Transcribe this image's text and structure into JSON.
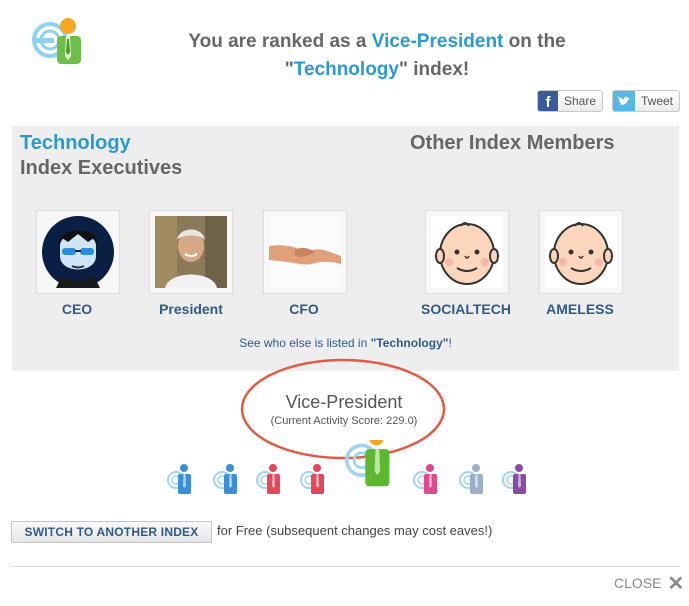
{
  "header": {
    "line1_prefix": "You are ranked as a ",
    "rank": "Vice-President",
    "line1_suffix": " on the",
    "line2_prefix": "\"",
    "index_name": "Technology",
    "line2_suffix": "\" index!"
  },
  "share": {
    "facebook_label": "Share",
    "twitter_label": "Tweet"
  },
  "panel": {
    "title_accent": "Technology",
    "title_rest": "Index Executives",
    "other_title": "Other Index Members",
    "executives": [
      {
        "label": "CEO",
        "icon": "ceo-avatar"
      },
      {
        "label": "President",
        "icon": "president-photo"
      },
      {
        "label": "CFO",
        "icon": "handshake-photo"
      }
    ],
    "others": [
      {
        "label": "SOCIALTECH",
        "icon": "baby-face-avatar"
      },
      {
        "label": "AMELESS",
        "icon": "baby-face-avatar"
      }
    ],
    "see_prefix": "See who else is listed in ",
    "see_link": "\"Technology\"",
    "see_suffix": "!"
  },
  "rank_box": {
    "title": "Vice-President",
    "score": "(Current Activity Score: 229.0)"
  },
  "levels": [
    {
      "color": "#3a8fd6"
    },
    {
      "color": "#3a8fd6"
    },
    {
      "color": "#e4465a"
    },
    {
      "color": "#e4465a"
    },
    {
      "color": "#5cb82e",
      "current": true
    },
    {
      "color": "#e04a8a"
    },
    {
      "color": "#9ab0c8"
    },
    {
      "color": "#8a4aa8"
    }
  ],
  "footer": {
    "switch_label": "SWITCH TO ANOTHER INDEX",
    "switch_text": "for Free (subsequent changes may cost eaves!)",
    "close_label": "CLOSE"
  },
  "colors": {
    "accent": "#2a9ad0",
    "link": "#2e5a8c",
    "ellipse": "#e25b44"
  }
}
